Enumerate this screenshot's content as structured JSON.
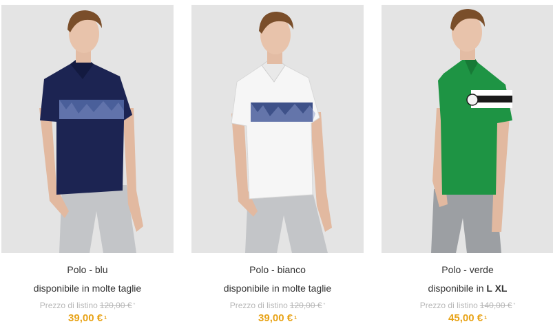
{
  "products": [
    {
      "name": "Polo - blu",
      "availability_prefix": "disponibile in molte taglie",
      "availability_sizes": "",
      "list_label": "Prezzo di listino",
      "list_price": "120,00 €",
      "list_marker": "*",
      "price": "39,00 €",
      "price_marker": "1",
      "image": "man-wearing-navy-polo-with-floral-chest-band",
      "shirt_color": "#1c2452",
      "band_color": "#4a5f9a"
    },
    {
      "name": "Polo - bianco",
      "availability_prefix": "disponibile in molte taglie",
      "availability_sizes": "",
      "list_label": "Prezzo di listino",
      "list_price": "120,00 €",
      "list_marker": "*",
      "price": "39,00 €",
      "price_marker": "1",
      "image": "man-wearing-white-polo-with-floral-chest-band",
      "shirt_color": "#f6f6f6",
      "band_color": "#3e5189"
    },
    {
      "name": "Polo - verde",
      "availability_prefix": "disponibile in",
      "availability_sizes": "L XL",
      "list_label": "Prezzo di listino",
      "list_price": "140,00 €",
      "list_marker": "*",
      "price": "45,00 €",
      "price_marker": "1",
      "image": "man-wearing-green-polo-with-black-white-stripes",
      "shirt_color": "#1e9444",
      "band_color": "#1a1a1a"
    }
  ],
  "colors": {
    "price": "#e8a317",
    "list_price": "#b7b7b7",
    "text": "#333333",
    "photo_bg": "#e3e3e3"
  }
}
